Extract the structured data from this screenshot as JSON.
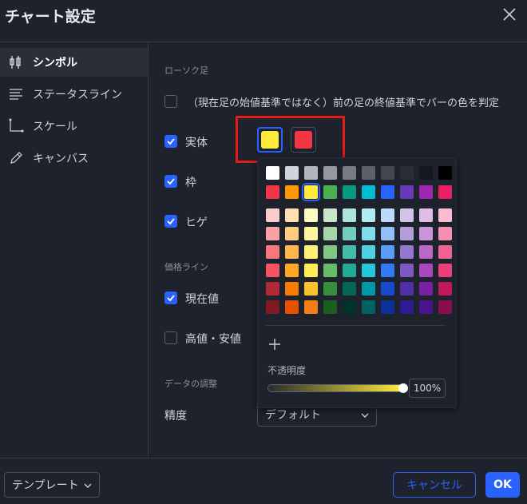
{
  "dialog": {
    "title": "チャート設定"
  },
  "sidebar": {
    "items": [
      {
        "label": "シンボル",
        "icon": "candles-icon",
        "active": true
      },
      {
        "label": "ステータスライン",
        "icon": "status-lines-icon",
        "active": false
      },
      {
        "label": "スケール",
        "icon": "scale-icon",
        "active": false
      },
      {
        "label": "キャンバス",
        "icon": "pencil-icon",
        "active": false
      }
    ]
  },
  "main": {
    "candles_section": "ローソク足",
    "base_color_option": "（現在足の始値基準ではなく）前の足の終値基準でバーの色を判定",
    "body_label": "実体",
    "border_label": "枠",
    "wick_label": "ヒゲ",
    "price_lines_section": "価格ライン",
    "last_price_label": "現在値",
    "high_low_label": "高値・安値",
    "data_adjust_section": "データの調整",
    "precision_label": "精度",
    "precision_value": "デフォルト",
    "body_up_color": "#ffeb3b",
    "body_down_color": "#f23645"
  },
  "palette": {
    "opacity_label": "不透明度",
    "opacity_value": "100%",
    "opacity_fraction": 1.0,
    "add_icon": "plus-icon",
    "selected_color": "#ffeb3b",
    "rows": [
      [
        "#ffffff",
        "#d1d4dc",
        "#b2b5be",
        "#9598a1",
        "#787b86",
        "#5d606b",
        "#434651",
        "#2a2e39",
        "#131722",
        "#000000"
      ],
      [
        "#f23645",
        "#ff9800",
        "#ffeb3b",
        "#4caf50",
        "#089981",
        "#00bcd4",
        "#2962ff",
        "#673ab7",
        "#9c27b0",
        "#e91e63"
      ],
      [
        "#fccbcd",
        "#ffe0b2",
        "#fff9c4",
        "#c8e6c9",
        "#ace5dc",
        "#b2ebf2",
        "#bbd9fb",
        "#d1c4e9",
        "#e1bee7",
        "#f8bbd0"
      ],
      [
        "#faa1a4",
        "#ffcc80",
        "#fff59d",
        "#a5d6a7",
        "#70ccbd",
        "#80deea",
        "#90bff9",
        "#b39ddb",
        "#ce93d8",
        "#f48fb1"
      ],
      [
        "#f7787b",
        "#ffb74d",
        "#fff176",
        "#81c784",
        "#42bda8",
        "#4dd0e1",
        "#5b9cf6",
        "#9575cd",
        "#ba68c8",
        "#f06292"
      ],
      [
        "#f7525f",
        "#ffa726",
        "#ffee58",
        "#66bb6a",
        "#22ab94",
        "#26c6da",
        "#3179f5",
        "#7e57c2",
        "#ab47bc",
        "#ec407a"
      ],
      [
        "#b22833",
        "#f57c00",
        "#fbc02d",
        "#388e3c",
        "#056656",
        "#0097a7",
        "#1848cc",
        "#512da8",
        "#7b1fa2",
        "#c2185b"
      ],
      [
        "#801922",
        "#e65100",
        "#f57f17",
        "#1b5e20",
        "#00332a",
        "#006064",
        "#0c3299",
        "#311b92",
        "#4a148c",
        "#880e4f"
      ]
    ]
  },
  "footer": {
    "template_label": "テンプレート",
    "cancel_label": "キャンセル",
    "ok_label": "OK"
  }
}
